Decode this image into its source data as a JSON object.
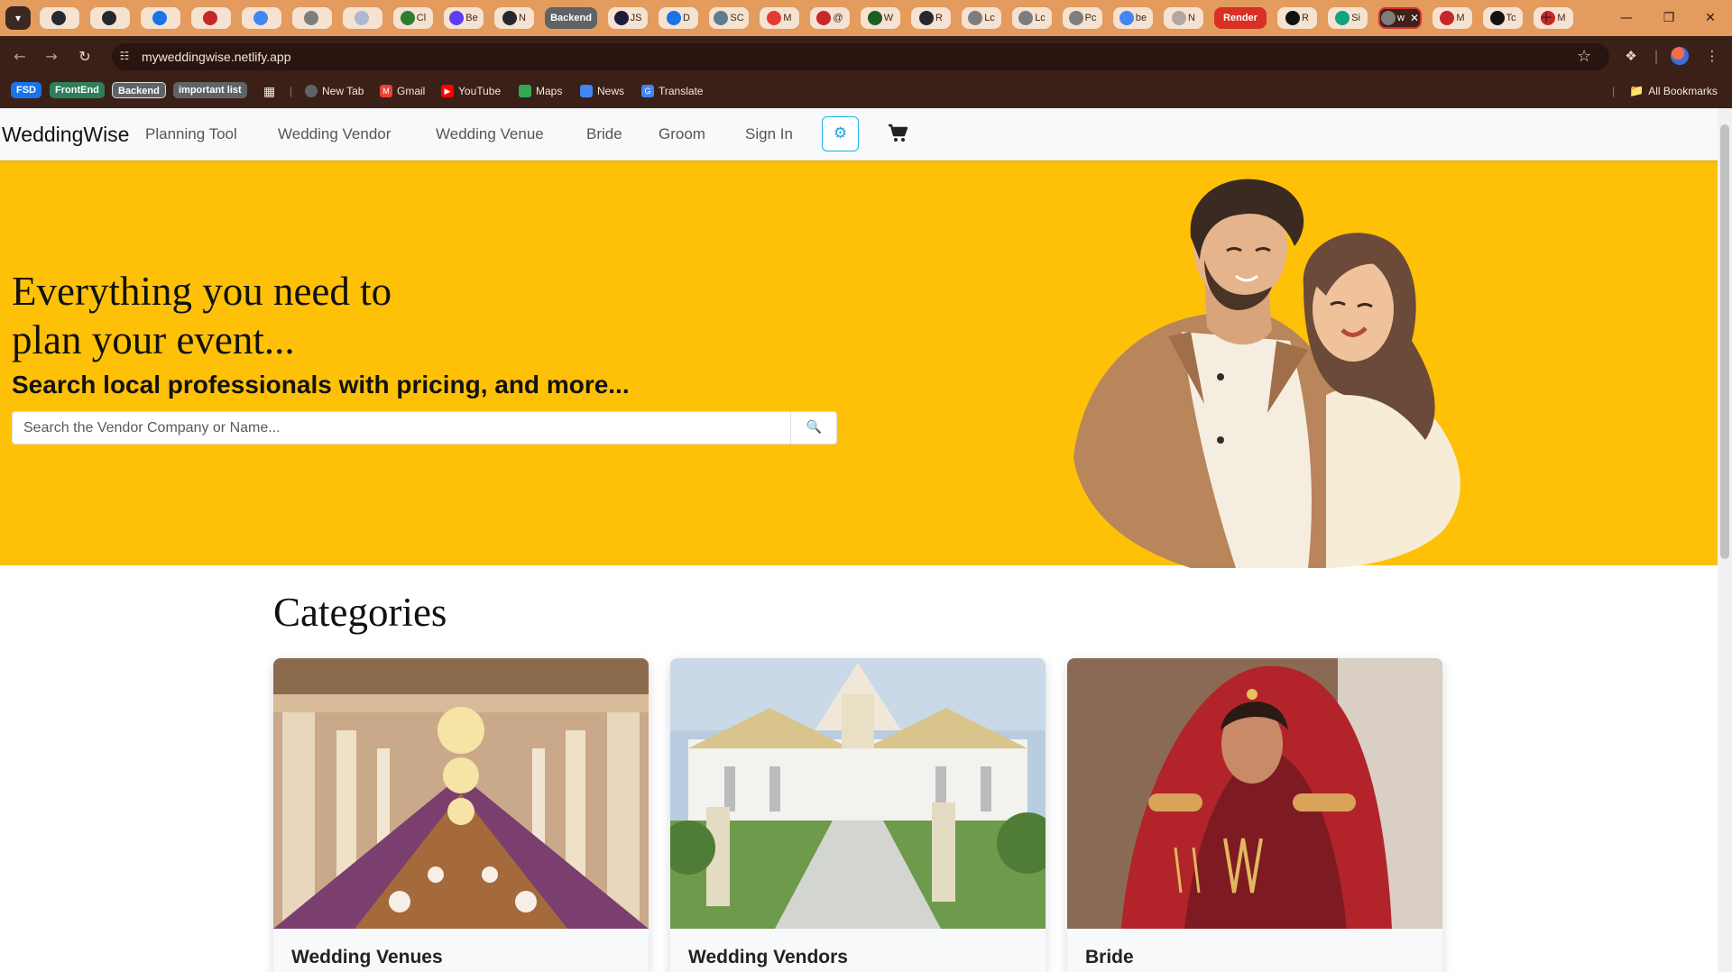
{
  "browser": {
    "tabs": [
      {
        "label": "",
        "icon": "github-icon"
      },
      {
        "label": "",
        "icon": "github-icon"
      },
      {
        "label": "",
        "icon": "app-icon"
      },
      {
        "label": "",
        "icon": "app-icon"
      },
      {
        "label": "",
        "icon": "google-icon"
      },
      {
        "label": "",
        "icon": "globe-icon"
      },
      {
        "label": "",
        "icon": "app-icon"
      },
      {
        "label": "Cl",
        "icon": "app-icon"
      },
      {
        "label": "Be",
        "icon": "app-icon"
      },
      {
        "label": "N",
        "icon": "app-icon"
      },
      {
        "label": "Backend",
        "icon": "tab-group"
      },
      {
        "label": "JS",
        "icon": "app-icon"
      },
      {
        "label": "D",
        "icon": "app-icon"
      },
      {
        "label": "SC",
        "icon": "app-icon"
      },
      {
        "label": "M",
        "icon": "app-icon"
      },
      {
        "label": "@",
        "icon": "app-icon"
      },
      {
        "label": "W",
        "icon": "app-icon"
      },
      {
        "label": "R",
        "icon": "github-icon"
      },
      {
        "label": "Lc",
        "icon": "globe-icon"
      },
      {
        "label": "Lc",
        "icon": "globe-icon"
      },
      {
        "label": "Pc",
        "icon": "globe-icon"
      },
      {
        "label": "be",
        "icon": "google-icon"
      },
      {
        "label": "N",
        "icon": "globe-icon"
      },
      {
        "label": "Render",
        "icon": "tab-group"
      },
      {
        "label": "R",
        "icon": "app-icon"
      },
      {
        "label": "Si",
        "icon": "app-icon"
      },
      {
        "label": "w",
        "icon": "active-tab"
      },
      {
        "label": "M",
        "icon": "app-icon"
      },
      {
        "label": "Tc",
        "icon": "app-icon"
      },
      {
        "label": "M",
        "icon": "app-icon"
      }
    ],
    "url": "myweddingwise.netlify.app",
    "bookmark_groups": [
      "FSD",
      "FrontEnd",
      "Backend",
      "important list"
    ],
    "bookmarks": [
      "New Tab",
      "Gmail",
      "YouTube",
      "Maps",
      "News",
      "Translate"
    ],
    "all_bookmarks": "All Bookmarks",
    "accent_color": "#E39B5E"
  },
  "site": {
    "brand": "WeddingWise",
    "nav": [
      "Planning Tool",
      "Wedding Vendor",
      "Wedding Venue",
      "Bride",
      "Groom",
      "Sign In"
    ],
    "theme_icon": "sun-icon",
    "cart_icon": "cart-icon",
    "hero": {
      "line1": "Everything you need to",
      "line2": "plan your event...",
      "subtitle": "Search local professionals with pricing, and more...",
      "search_placeholder": "Search the Vendor Company or Name...",
      "background": "#FFC107"
    },
    "categories_title": "Categories",
    "categories": [
      {
        "title": "Wedding Venues"
      },
      {
        "title": "Wedding Vendors"
      },
      {
        "title": "Bride"
      }
    ]
  }
}
